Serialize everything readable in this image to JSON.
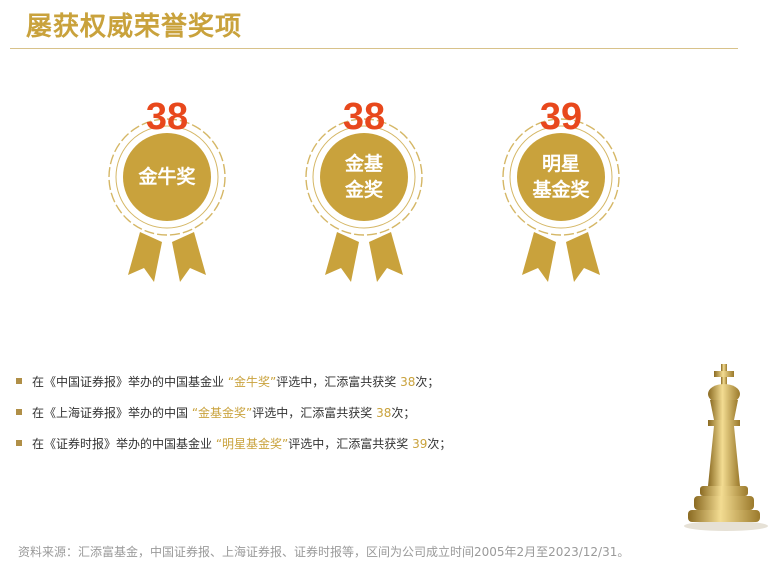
{
  "title": "屡获权威荣誉奖项",
  "badges": [
    {
      "count": "38",
      "line1": "金牛奖",
      "line2": ""
    },
    {
      "count": "38",
      "line1": "金基",
      "line2": "金奖"
    },
    {
      "count": "39",
      "line1": "明星",
      "line2": "基金奖"
    }
  ],
  "bullets": [
    {
      "before": "在《中国证券报》举办的中国基金业 ",
      "award": "“金牛奖”",
      "middle": "评选中，汇添富共获奖 ",
      "num": "38",
      "after": "次；"
    },
    {
      "before": "在《上海证券报》举办的中国 ",
      "award": "“金基金奖”",
      "middle": "评选中，汇添富共获奖 ",
      "num": "38",
      "after": "次；"
    },
    {
      "before": "在《证券时报》举办的中国基金业 ",
      "award": "“明星基金奖”",
      "middle": "评选中，汇添富共获奖 ",
      "num": "39",
      "after": "次；"
    }
  ],
  "source": "资料来源：汇添富基金，中国证券报、上海证券报、证券时报等，区间为公司成立时间2005年2月至2023/12/31。",
  "colors": {
    "gold": "#c9a23c",
    "count_red": "#e8481c",
    "bullet": "#b08f47"
  },
  "decoration": {
    "icon": "chess-king-icon"
  }
}
